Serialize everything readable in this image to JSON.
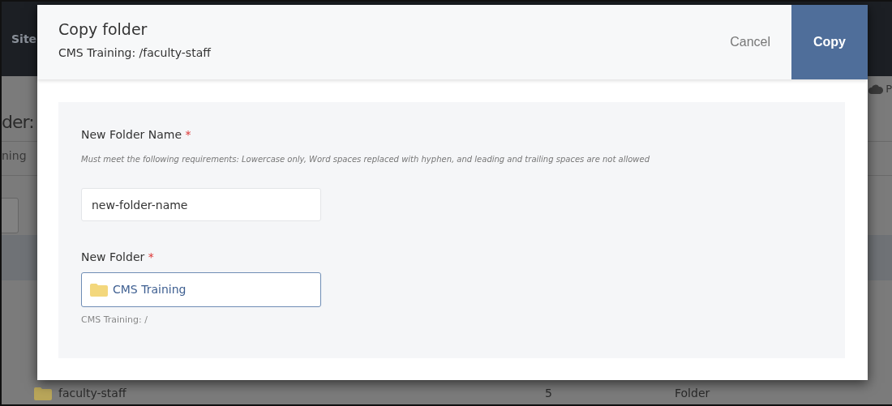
{
  "background": {
    "nav_item": "Site",
    "heading": "der:",
    "subheading": "ning",
    "action": "P",
    "rows": [
      {
        "name": "faculty-staff",
        "column_2": "5",
        "column_3": "Folder"
      }
    ]
  },
  "dialog": {
    "title": "Copy folder",
    "subtitle": "CMS Training: /faculty-staff",
    "buttons": [
      {
        "label": "Cancel",
        "kind": "secondary"
      },
      {
        "label": "Copy",
        "kind": "primary"
      }
    ],
    "fields": [
      {
        "kind": "text",
        "label": "New Folder Name",
        "required_mark": "*",
        "hint": "Must meet the following requirements: Lowercase only, Word spaces replaced with hyphen, and leading and trailing spaces are not allowed",
        "value": "new-folder-name"
      },
      {
        "kind": "folder",
        "label": "New Folder",
        "required_mark": "*",
        "value": "CMS Training",
        "help": "CMS Training: /"
      }
    ]
  }
}
